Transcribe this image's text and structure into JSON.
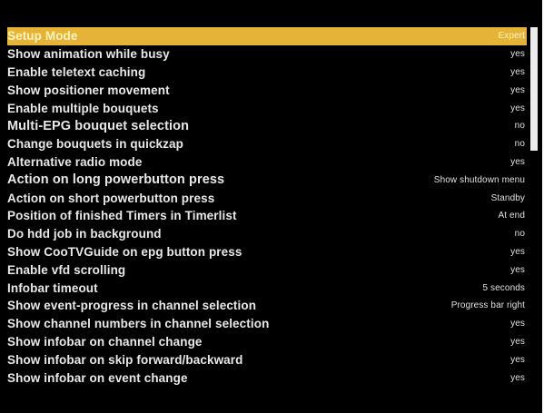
{
  "menu": {
    "items": [
      {
        "label": "Setup Mode",
        "value": "Expert"
      },
      {
        "label": "Show animation while busy",
        "value": "yes"
      },
      {
        "label": "Enable teletext caching",
        "value": "yes"
      },
      {
        "label": "Show positioner movement",
        "value": "yes"
      },
      {
        "label": "Enable multiple bouquets",
        "value": "yes"
      },
      {
        "label": "Multi-EPG bouquet selection",
        "value": "no"
      },
      {
        "label": "Change bouquets in quickzap",
        "value": "no"
      },
      {
        "label": "Alternative radio mode",
        "value": "yes"
      },
      {
        "label": "Action on long powerbutton press",
        "value": "Show shutdown menu"
      },
      {
        "label": "Action on short powerbutton press",
        "value": "Standby"
      },
      {
        "label": "Position of finished Timers in Timerlist",
        "value": "At end"
      },
      {
        "label": "Do hdd job in background",
        "value": "no"
      },
      {
        "label": "Show CooTVGuide on epg button press",
        "value": "yes"
      },
      {
        "label": "Enable vfd scrolling",
        "value": "yes"
      },
      {
        "label": "Infobar timeout",
        "value": "5 seconds"
      },
      {
        "label": "Show event-progress in channel selection",
        "value": "Progress bar right"
      },
      {
        "label": "Show channel numbers in channel selection",
        "value": "yes"
      },
      {
        "label": "Show infobar on channel change",
        "value": "yes"
      },
      {
        "label": "Show infobar on skip forward/backward",
        "value": "yes"
      },
      {
        "label": "Show infobar on event change",
        "value": "yes"
      }
    ],
    "selected_index": 0
  },
  "colors": {
    "background": "#000000",
    "highlight": "#e4b338",
    "text": "#e8e8e8"
  },
  "scrollbar": {
    "position_fraction": 0.0,
    "visible_fraction": 0.32
  }
}
